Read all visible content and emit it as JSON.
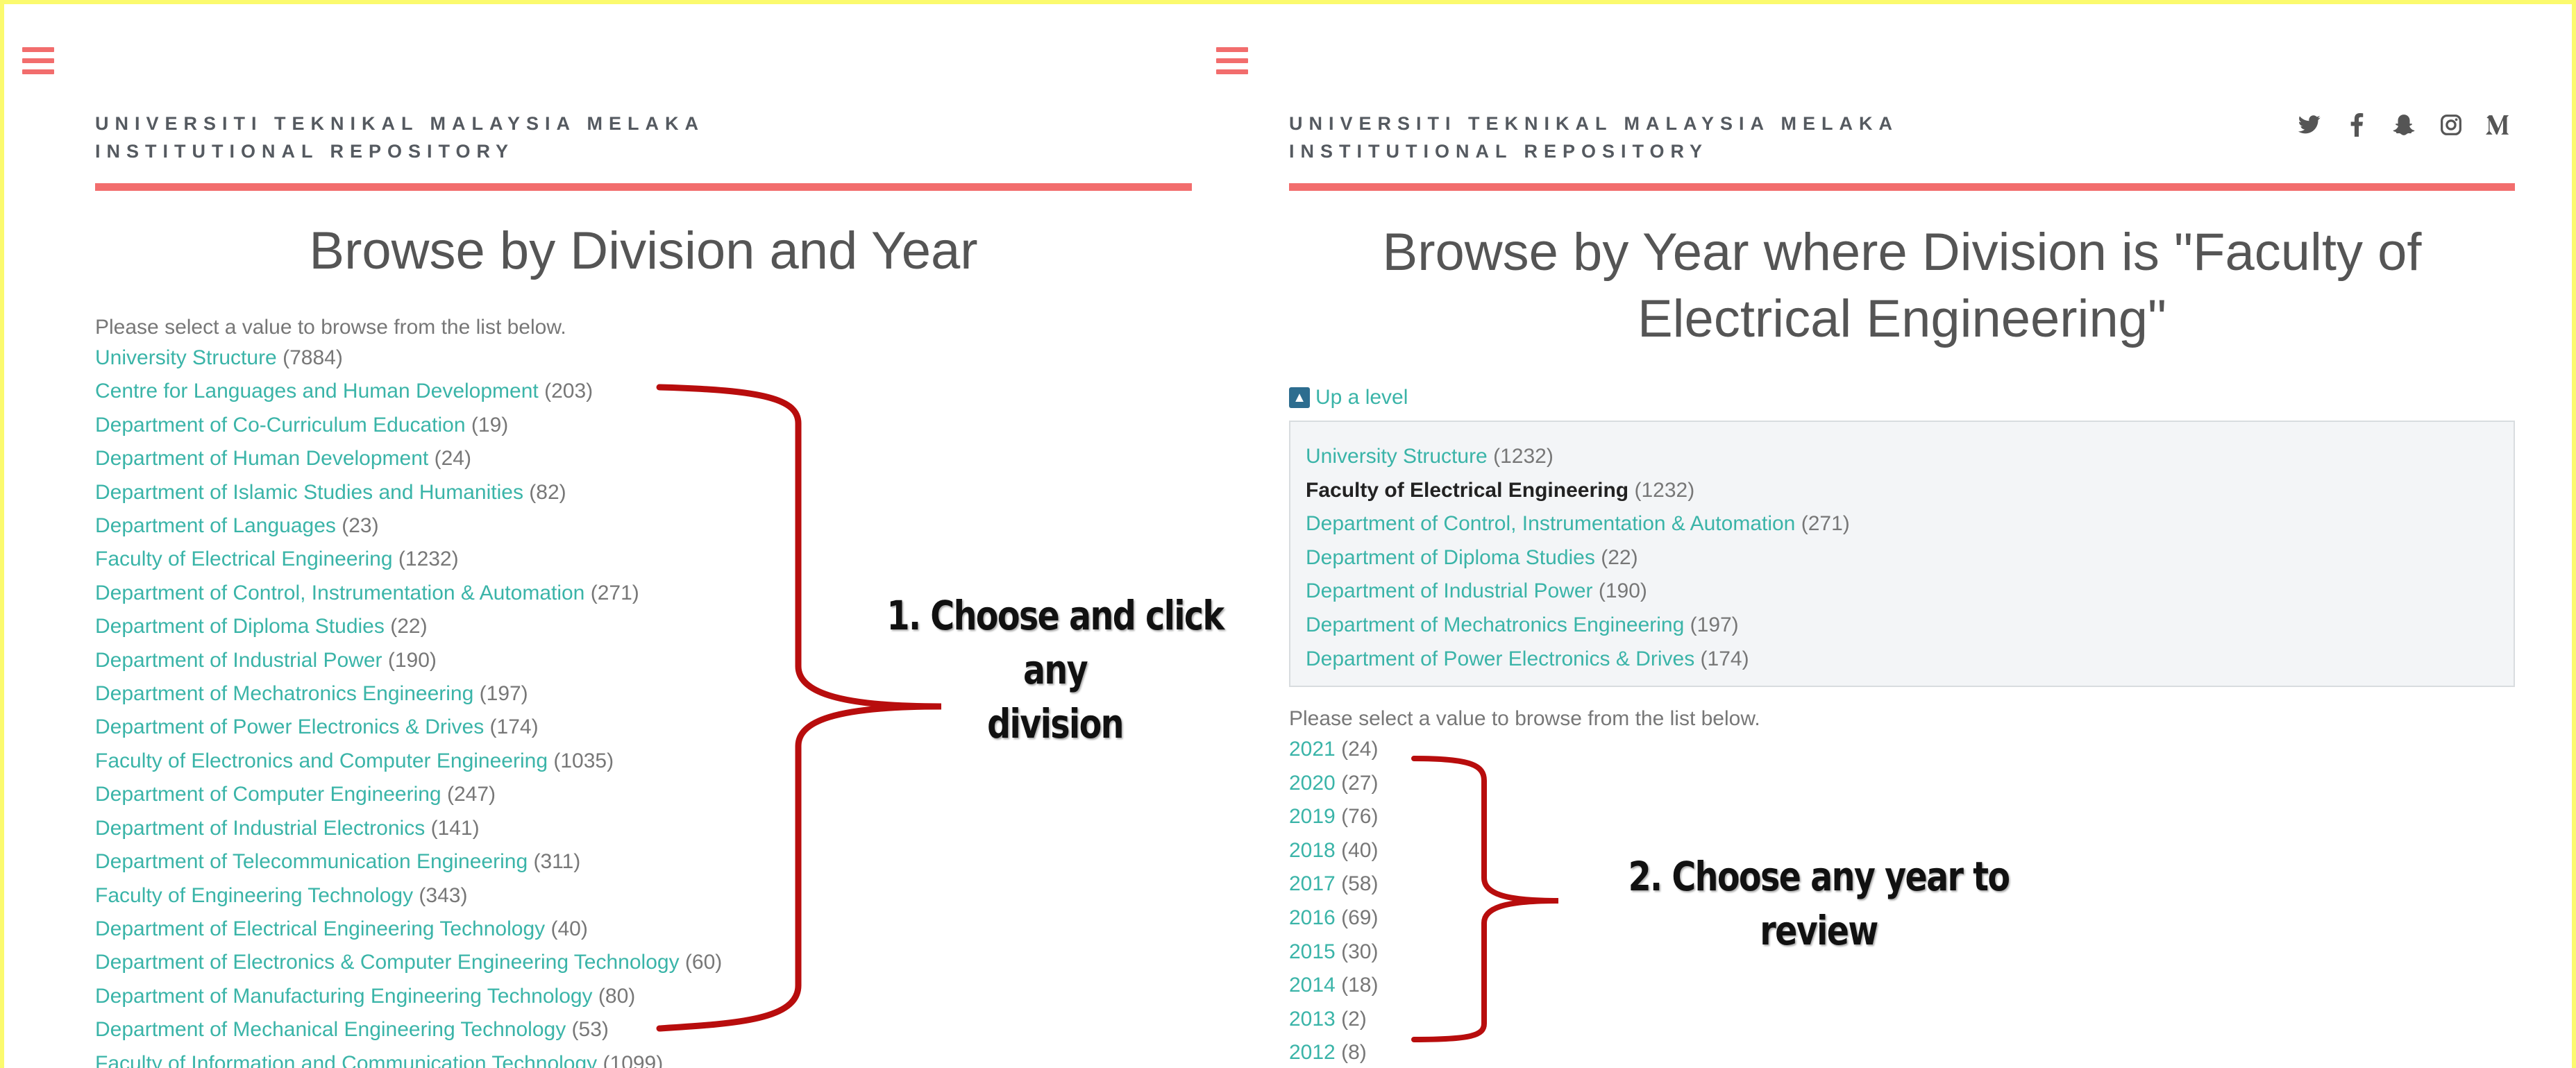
{
  "colors": {
    "accent": "#f26d6d",
    "link": "#3ab4a8",
    "border": "#fbfa6e",
    "bracket": "#b80d0d"
  },
  "left": {
    "menu_icon": "hamburger-icon",
    "brand_line1": "UNIVERSITI TEKNIKAL MALAYSIA MELAKA",
    "brand_line2": "INSTITUTIONAL REPOSITORY",
    "title": "Browse by Division and Year",
    "intro": "Please select a value to browse from the list below.",
    "items": [
      {
        "label": "University Structure",
        "count": "(7884)"
      },
      {
        "label": "Centre for Languages and Human Development",
        "count": "(203)"
      },
      {
        "label": "Department of Co-Curriculum Education",
        "count": "(19)"
      },
      {
        "label": "Department of Human Development",
        "count": "(24)"
      },
      {
        "label": "Department of Islamic Studies and Humanities",
        "count": "(82)"
      },
      {
        "label": "Department of Languages",
        "count": "(23)"
      },
      {
        "label": "Faculty of Electrical Engineering",
        "count": "(1232)"
      },
      {
        "label": "Department of Control, Instrumentation & Automation",
        "count": "(271)"
      },
      {
        "label": "Department of Diploma Studies",
        "count": "(22)"
      },
      {
        "label": "Department of Industrial Power",
        "count": "(190)"
      },
      {
        "label": "Department of Mechatronics Engineering",
        "count": "(197)"
      },
      {
        "label": "Department of Power Electronics & Drives",
        "count": "(174)"
      },
      {
        "label": "Faculty of Electronics and Computer Engineering",
        "count": "(1035)"
      },
      {
        "label": "Department of Computer Engineering",
        "count": "(247)"
      },
      {
        "label": "Department of Industrial Electronics",
        "count": "(141)"
      },
      {
        "label": "Department of Telecommunication Engineering",
        "count": "(311)"
      },
      {
        "label": "Faculty of Engineering Technology",
        "count": "(343)"
      },
      {
        "label": "Department of Electrical Engineering Technology",
        "count": "(40)"
      },
      {
        "label": "Department of Electronics & Computer Engineering Technology",
        "count": "(60)"
      },
      {
        "label": "Department of Manufacturing Engineering Technology",
        "count": "(80)"
      },
      {
        "label": "Department of Mechanical Engineering Technology",
        "count": "(53)"
      },
      {
        "label": "Faculty of Information and Communication Technology",
        "count": "(1099)"
      }
    ]
  },
  "right": {
    "menu_icon": "hamburger-icon",
    "brand_line1": "UNIVERSITI TEKNIKAL MALAYSIA MELAKA",
    "brand_line2": "INSTITUTIONAL REPOSITORY",
    "social_icons": [
      "twitter-icon",
      "facebook-icon",
      "snapchat-icon",
      "instagram-icon",
      "medium-icon"
    ],
    "title_line1": "Browse by Year where Division is \"Faculty of",
    "title_line2": "Electrical Engineering\"",
    "up_level": "Up a level",
    "crumbs": [
      {
        "label": "University Structure",
        "count": "(1232)",
        "current": false
      },
      {
        "label": "Faculty of Electrical Engineering",
        "count": "(1232)",
        "current": true
      },
      {
        "label": "Department of Control, Instrumentation & Automation",
        "count": "(271)",
        "current": false
      },
      {
        "label": "Department of Diploma Studies",
        "count": "(22)",
        "current": false
      },
      {
        "label": "Department of Industrial Power",
        "count": "(190)",
        "current": false
      },
      {
        "label": "Department of Mechatronics Engineering",
        "count": "(197)",
        "current": false
      },
      {
        "label": "Department of Power Electronics & Drives",
        "count": "(174)",
        "current": false
      }
    ],
    "intro": "Please select a value to browse from the list below.",
    "years": [
      {
        "label": "2021",
        "count": "(24)"
      },
      {
        "label": "2020",
        "count": "(27)"
      },
      {
        "label": "2019",
        "count": "(76)"
      },
      {
        "label": "2018",
        "count": "(40)"
      },
      {
        "label": "2017",
        "count": "(58)"
      },
      {
        "label": "2016",
        "count": "(69)"
      },
      {
        "label": "2015",
        "count": "(30)"
      },
      {
        "label": "2014",
        "count": "(18)"
      },
      {
        "label": "2013",
        "count": "(2)"
      },
      {
        "label": "2012",
        "count": "(8)"
      }
    ]
  },
  "annotations": {
    "callout_1_line1": "1. Choose and click any",
    "callout_1_line2": "division",
    "callout_2_line1": "2. Choose any year to",
    "callout_2_line2": "review"
  }
}
